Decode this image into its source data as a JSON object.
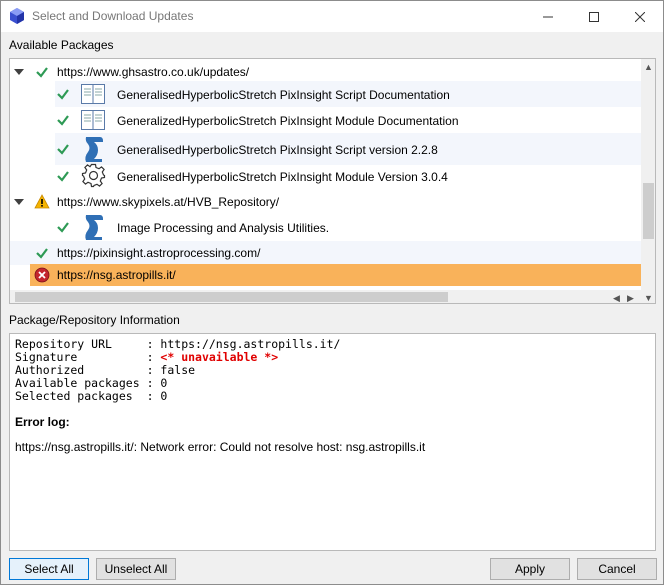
{
  "window": {
    "title": "Select and Download Updates"
  },
  "packages_section": {
    "label": "Available Packages",
    "repositories": [
      {
        "url": "https://www.ghsastro.co.uk/updates/",
        "status": "ok",
        "expanded": true,
        "packages": [
          {
            "label": "GeneralisedHyperbolicStretch PixInsight Script Documentation",
            "type_icon": "book-icon",
            "checked": true
          },
          {
            "label": "GeneralizedHyperbolicStretch PixInsight Module Documentation",
            "type_icon": "book-icon",
            "checked": true
          },
          {
            "label": "GeneralisedHyperbolicStretch PixInsight Script version 2.2.8",
            "type_icon": "script-icon",
            "checked": true
          },
          {
            "label": "GeneralisedHyperbolicStretch PixInsight Module Version 3.0.4",
            "type_icon": "gear-icon",
            "checked": true
          }
        ]
      },
      {
        "url": "https://www.skypixels.at/HVB_Repository/",
        "status": "warning",
        "expanded": true,
        "packages": [
          {
            "label": "Image Processing and Analysis Utilities.",
            "type_icon": "script-icon",
            "checked": true
          }
        ]
      },
      {
        "url": "https://pixinsight.astroprocessing.com/",
        "status": "ok",
        "expanded": false,
        "packages": []
      },
      {
        "url": "https://nsg.astropills.it/",
        "status": "error",
        "expanded": false,
        "selected": true,
        "packages": []
      }
    ]
  },
  "info_section": {
    "label": "Package/Repository Information",
    "lines": [
      {
        "key": "Repository URL     ",
        "value": "https://nsg.astropills.it/"
      },
      {
        "key": "Signature          ",
        "value": "<* unavailable *>"
      },
      {
        "key": "Authorized         ",
        "value": "false"
      },
      {
        "key": "Available packages ",
        "value": "0"
      },
      {
        "key": "Selected packages  ",
        "value": "0"
      }
    ],
    "error_title": "Error log:",
    "error_message": "https://nsg.astropills.it/: Network error: Could not resolve host: nsg.astropills.it"
  },
  "buttons": {
    "select_all": "Select All",
    "unselect_all": "Unselect All",
    "apply": "Apply",
    "cancel": "Cancel"
  },
  "colors": {
    "selected_row": "#f9b25a",
    "check_green": "#2e9a55",
    "error_red": "#e00000",
    "script_blue": "#2f6fb5"
  }
}
